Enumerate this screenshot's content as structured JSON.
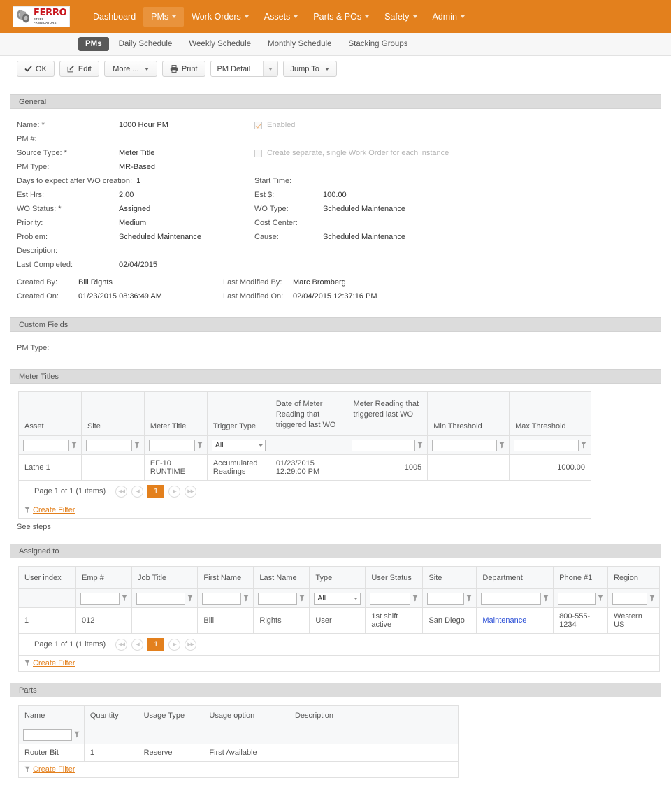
{
  "brand": {
    "name": "FERRO",
    "tagline": "STEEL FABRICATORS",
    "accent": "#e3801d",
    "logo_red": "#c8161d"
  },
  "topnav": {
    "items": [
      {
        "label": "Dashboard",
        "has_caret": false,
        "active": false
      },
      {
        "label": "PMs",
        "has_caret": true,
        "active": true
      },
      {
        "label": "Work Orders",
        "has_caret": true,
        "active": false
      },
      {
        "label": "Assets",
        "has_caret": true,
        "active": false
      },
      {
        "label": "Parts & POs",
        "has_caret": true,
        "active": false
      },
      {
        "label": "Safety",
        "has_caret": true,
        "active": false
      },
      {
        "label": "Admin",
        "has_caret": true,
        "active": false
      }
    ]
  },
  "subnav": {
    "items": [
      {
        "label": "PMs",
        "active": true
      },
      {
        "label": "Daily Schedule",
        "active": false
      },
      {
        "label": "Weekly Schedule",
        "active": false
      },
      {
        "label": "Monthly Schedule",
        "active": false
      },
      {
        "label": "Stacking Groups",
        "active": false
      }
    ]
  },
  "toolbar": {
    "ok_label": "OK",
    "edit_label": "Edit",
    "more_label": "More ...",
    "print_label": "Print",
    "view_select_value": "PM Detail",
    "jump_to_label": "Jump To"
  },
  "general": {
    "title": "General",
    "name_label": "Name: *",
    "name_value": "1000 Hour PM",
    "pm_number_label": "PM #:",
    "pm_number_value": "",
    "source_type_label": "Source Type: *",
    "source_type_value": "Meter Title",
    "pm_type_label": "PM Type:",
    "pm_type_value": "MR-Based",
    "days_label": "Days to expect after WO creation:",
    "days_value": "1",
    "est_hrs_label": "Est Hrs:",
    "est_hrs_value": "2.00",
    "wo_status_label": "WO Status: *",
    "wo_status_value": "Assigned",
    "priority_label": "Priority:",
    "priority_value": "Medium",
    "problem_label": "Problem:",
    "problem_value": "Scheduled Maintenance",
    "description_label": "Description:",
    "description_value": "",
    "last_completed_label": "Last Completed:",
    "last_completed_value": "02/04/2015",
    "created_by_label": "Created By:",
    "created_by_value": "Bill Rights",
    "created_on_label": "Created On:",
    "created_on_value": "01/23/2015 08:36:49 AM",
    "enabled_label": "Enabled",
    "enabled_checked": true,
    "separate_wo_label": "Create separate, single Work Order for each instance",
    "separate_wo_checked": false,
    "start_time_label": "Start Time:",
    "start_time_value": "",
    "est_dollars_label": "Est $:",
    "est_dollars_value": "100.00",
    "wo_type_label": "WO Type:",
    "wo_type_value": "Scheduled Maintenance",
    "cost_center_label": "Cost Center:",
    "cost_center_value": "",
    "cause_label": "Cause:",
    "cause_value": "Scheduled Maintenance",
    "last_modified_by_label": "Last Modified By:",
    "last_modified_by_value": "Marc Bromberg",
    "last_modified_on_label": "Last Modified On:",
    "last_modified_on_value": "02/04/2015 12:37:16 PM"
  },
  "custom_fields": {
    "title": "Custom Fields",
    "pm_type_label": "PM Type:",
    "pm_type_value": ""
  },
  "meter_titles": {
    "title": "Meter Titles",
    "columns": [
      "Asset",
      "Site",
      "Meter Title",
      "Trigger Type",
      "Date of Meter Reading that triggered last WO",
      "Meter Reading that triggered last WO",
      "Min Threshold",
      "Max Threshold"
    ],
    "filter_select_value": "All",
    "rows": [
      {
        "asset": "Lathe 1",
        "site": "",
        "meter_title": "EF-10 RUNTIME",
        "trigger_type": "Accumulated Readings",
        "date_of_reading": "01/23/2015 12:29:00 PM",
        "meter_reading": "1005",
        "min_threshold": "",
        "max_threshold": "1000.00"
      }
    ],
    "pager_text": "Page 1 of 1 (1 items)",
    "current_page": "1",
    "create_filter_label": "Create Filter"
  },
  "see_steps_label": "See steps",
  "assigned_to": {
    "title": "Assigned to",
    "columns": [
      "User index",
      "Emp #",
      "Job Title",
      "First Name",
      "Last Name",
      "Type",
      "User Status",
      "Site",
      "Department",
      "Phone #1",
      "Region"
    ],
    "filter_select_value": "All",
    "rows": [
      {
        "user_index": "1",
        "emp_no": "012",
        "job_title": "",
        "first_name": "Bill",
        "last_name": "Rights",
        "type": "User",
        "user_status": "1st shift active",
        "site": "San Diego",
        "department": "Maintenance",
        "phone": "800-555-1234",
        "region": "Western US"
      }
    ],
    "pager_text": "Page 1 of 1 (1 items)",
    "current_page": "1",
    "create_filter_label": "Create Filter"
  },
  "parts": {
    "title": "Parts",
    "columns": [
      "Name",
      "Quantity",
      "Usage Type",
      "Usage option",
      "Description"
    ],
    "rows": [
      {
        "name": "Router Bit",
        "quantity": "1",
        "usage_type": "Reserve",
        "usage_option": "First Available",
        "description": ""
      }
    ],
    "create_filter_label": "Create Filter"
  },
  "icons": {
    "check": "✔",
    "pencil": "✎",
    "printer": "🖶",
    "first": "◀◀",
    "prev": "◀",
    "next": "▶",
    "last": "▶▶"
  }
}
